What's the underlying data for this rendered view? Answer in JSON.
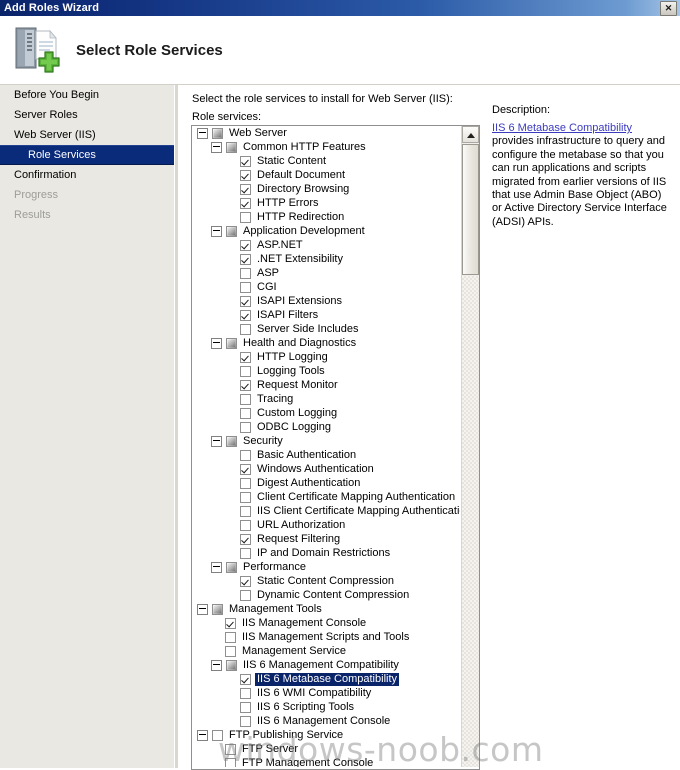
{
  "window": {
    "title": "Add Roles Wizard",
    "close_label": "✕"
  },
  "header": {
    "title": "Select Role Services",
    "icon": "server-add-icon"
  },
  "sidebar": {
    "items": [
      {
        "label": "Before You Begin",
        "state": "normal",
        "level": 0
      },
      {
        "label": "Server Roles",
        "state": "normal",
        "level": 0
      },
      {
        "label": "Web Server (IIS)",
        "state": "normal",
        "level": 0
      },
      {
        "label": "Role Services",
        "state": "selected",
        "level": 1
      },
      {
        "label": "Confirmation",
        "state": "normal",
        "level": 0
      },
      {
        "label": "Progress",
        "state": "disabled",
        "level": 0
      },
      {
        "label": "Results",
        "state": "disabled",
        "level": 0
      }
    ]
  },
  "main": {
    "instruction": "Select the role services to install for Web Server (IIS):",
    "tree_label": "Role services:"
  },
  "tree": {
    "rows": [
      {
        "label": "Web Server",
        "level": 0,
        "expander": "minus",
        "check": "partial",
        "selected": false
      },
      {
        "label": "Common HTTP Features",
        "level": 1,
        "expander": "minus",
        "check": "partial",
        "selected": false
      },
      {
        "label": "Static Content",
        "level": 2,
        "expander": "none",
        "check": "checked",
        "selected": false
      },
      {
        "label": "Default Document",
        "level": 2,
        "expander": "none",
        "check": "checked",
        "selected": false
      },
      {
        "label": "Directory Browsing",
        "level": 2,
        "expander": "none",
        "check": "checked",
        "selected": false
      },
      {
        "label": "HTTP Errors",
        "level": 2,
        "expander": "none",
        "check": "checked",
        "selected": false
      },
      {
        "label": "HTTP Redirection",
        "level": 2,
        "expander": "none",
        "check": "unchecked",
        "selected": false
      },
      {
        "label": "Application Development",
        "level": 1,
        "expander": "minus",
        "check": "partial",
        "selected": false
      },
      {
        "label": "ASP.NET",
        "level": 2,
        "expander": "none",
        "check": "checked",
        "selected": false
      },
      {
        "label": ".NET Extensibility",
        "level": 2,
        "expander": "none",
        "check": "checked",
        "selected": false
      },
      {
        "label": "ASP",
        "level": 2,
        "expander": "none",
        "check": "unchecked",
        "selected": false
      },
      {
        "label": "CGI",
        "level": 2,
        "expander": "none",
        "check": "unchecked",
        "selected": false
      },
      {
        "label": "ISAPI Extensions",
        "level": 2,
        "expander": "none",
        "check": "checked",
        "selected": false
      },
      {
        "label": "ISAPI Filters",
        "level": 2,
        "expander": "none",
        "check": "checked",
        "selected": false
      },
      {
        "label": "Server Side Includes",
        "level": 2,
        "expander": "none",
        "check": "unchecked",
        "selected": false
      },
      {
        "label": "Health and Diagnostics",
        "level": 1,
        "expander": "minus",
        "check": "partial",
        "selected": false
      },
      {
        "label": "HTTP Logging",
        "level": 2,
        "expander": "none",
        "check": "checked",
        "selected": false
      },
      {
        "label": "Logging Tools",
        "level": 2,
        "expander": "none",
        "check": "unchecked",
        "selected": false
      },
      {
        "label": "Request Monitor",
        "level": 2,
        "expander": "none",
        "check": "checked",
        "selected": false
      },
      {
        "label": "Tracing",
        "level": 2,
        "expander": "none",
        "check": "unchecked",
        "selected": false
      },
      {
        "label": "Custom Logging",
        "level": 2,
        "expander": "none",
        "check": "unchecked",
        "selected": false
      },
      {
        "label": "ODBC Logging",
        "level": 2,
        "expander": "none",
        "check": "unchecked",
        "selected": false
      },
      {
        "label": "Security",
        "level": 1,
        "expander": "minus",
        "check": "partial",
        "selected": false
      },
      {
        "label": "Basic Authentication",
        "level": 2,
        "expander": "none",
        "check": "unchecked",
        "selected": false
      },
      {
        "label": "Windows Authentication",
        "level": 2,
        "expander": "none",
        "check": "checked",
        "selected": false
      },
      {
        "label": "Digest Authentication",
        "level": 2,
        "expander": "none",
        "check": "unchecked",
        "selected": false
      },
      {
        "label": "Client Certificate Mapping Authentication",
        "level": 2,
        "expander": "none",
        "check": "unchecked",
        "selected": false
      },
      {
        "label": "IIS Client Certificate Mapping Authentication",
        "level": 2,
        "expander": "none",
        "check": "unchecked",
        "selected": false
      },
      {
        "label": "URL Authorization",
        "level": 2,
        "expander": "none",
        "check": "unchecked",
        "selected": false
      },
      {
        "label": "Request Filtering",
        "level": 2,
        "expander": "none",
        "check": "checked",
        "selected": false
      },
      {
        "label": "IP and Domain Restrictions",
        "level": 2,
        "expander": "none",
        "check": "unchecked",
        "selected": false
      },
      {
        "label": "Performance",
        "level": 1,
        "expander": "minus",
        "check": "partial",
        "selected": false
      },
      {
        "label": "Static Content Compression",
        "level": 2,
        "expander": "none",
        "check": "checked",
        "selected": false
      },
      {
        "label": "Dynamic Content Compression",
        "level": 2,
        "expander": "none",
        "check": "unchecked",
        "selected": false
      },
      {
        "label": "Management Tools",
        "level": 0,
        "expander": "minus",
        "check": "partial",
        "selected": false
      },
      {
        "label": "IIS Management Console",
        "level": 1,
        "expander": "none",
        "check": "checked",
        "selected": false
      },
      {
        "label": "IIS Management Scripts and Tools",
        "level": 1,
        "expander": "none",
        "check": "unchecked",
        "selected": false
      },
      {
        "label": "Management Service",
        "level": 1,
        "expander": "none",
        "check": "unchecked",
        "selected": false
      },
      {
        "label": "IIS 6 Management Compatibility",
        "level": 1,
        "expander": "minus",
        "check": "partial",
        "selected": false
      },
      {
        "label": "IIS 6 Metabase Compatibility",
        "level": 2,
        "expander": "none",
        "check": "checked",
        "selected": true
      },
      {
        "label": "IIS 6 WMI Compatibility",
        "level": 2,
        "expander": "none",
        "check": "unchecked",
        "selected": false
      },
      {
        "label": "IIS 6 Scripting Tools",
        "level": 2,
        "expander": "none",
        "check": "unchecked",
        "selected": false
      },
      {
        "label": "IIS 6 Management Console",
        "level": 2,
        "expander": "none",
        "check": "unchecked",
        "selected": false
      },
      {
        "label": "FTP Publishing Service",
        "level": 0,
        "expander": "minus",
        "check": "unchecked",
        "selected": false
      },
      {
        "label": "FTP Server",
        "level": 1,
        "expander": "none",
        "check": "unchecked",
        "selected": false
      },
      {
        "label": "FTP Management Console",
        "level": 1,
        "expander": "none",
        "check": "unchecked",
        "selected": false
      }
    ]
  },
  "description": {
    "heading": "Description:",
    "link_text": "IIS 6 Metabase Compatibility",
    "body": " provides infrastructure to query and configure the metabase so that you can run applications and scripts migrated from earlier versions of IIS that use Admin Base Object (ABO) or Active Directory Service Interface (ADSI) APIs."
  },
  "watermark": {
    "text": "windows-noob.com"
  }
}
